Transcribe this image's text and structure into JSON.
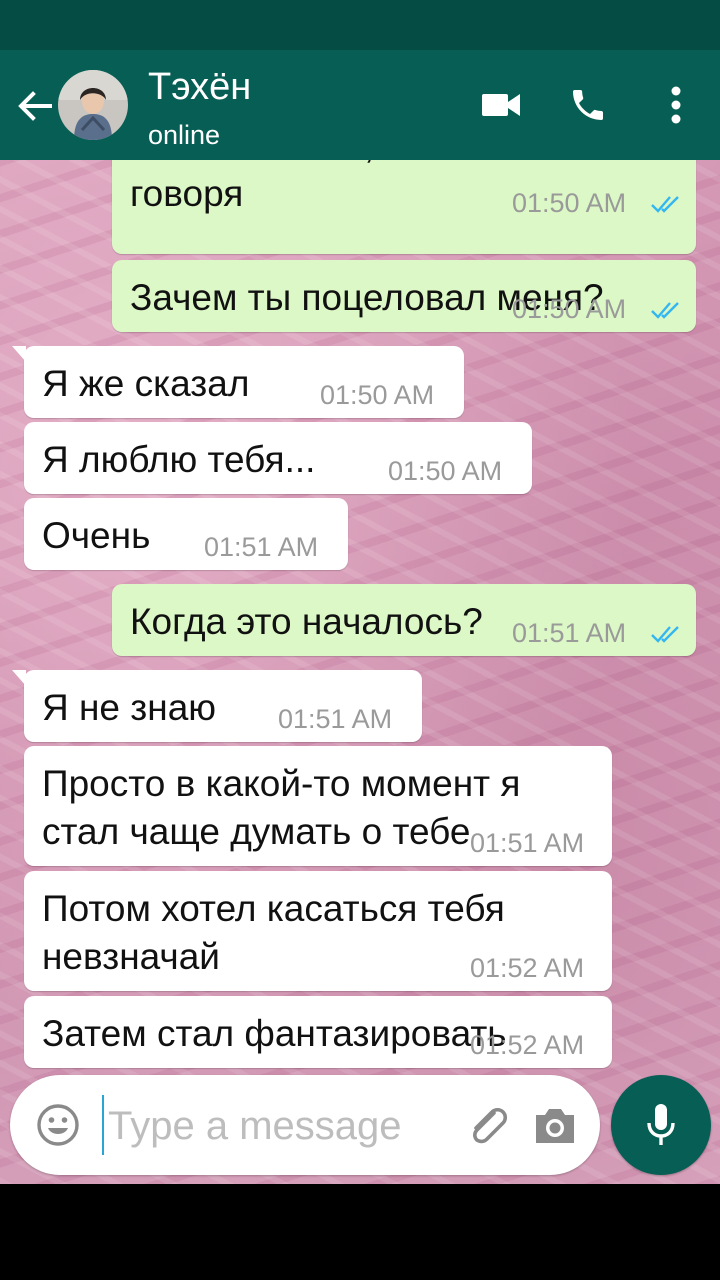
{
  "header": {
    "contact_name": "Тэхён",
    "status": "online",
    "icons": [
      "back-arrow-icon",
      "video-call-icon",
      "phone-icon",
      "more-vert-icon"
    ]
  },
  "messages": [
    {
      "direction": "out",
      "lines": [
        "Я был в шоке,честно",
        "говоря"
      ],
      "time": "01:50 AM",
      "read": true
    },
    {
      "direction": "out",
      "lines": [
        "Зачем ты поцеловал меня?"
      ],
      "time": "01:50 AM",
      "read": true
    },
    {
      "direction": "in",
      "lines": [
        "Я же сказал"
      ],
      "time": "01:50 AM"
    },
    {
      "direction": "in",
      "lines": [
        "Я люблю тебя..."
      ],
      "time": "01:50 AM"
    },
    {
      "direction": "in",
      "lines": [
        "Очень"
      ],
      "time": "01:51 AM"
    },
    {
      "direction": "out",
      "lines": [
        "Когда это началось?"
      ],
      "time": "01:51 AM",
      "read": true
    },
    {
      "direction": "in",
      "lines": [
        "Я не знаю"
      ],
      "time": "01:51 AM"
    },
    {
      "direction": "in",
      "lines": [
        "Просто в какой-то момент я",
        "стал чаще думать о тебе"
      ],
      "time": "01:51 AM"
    },
    {
      "direction": "in",
      "lines": [
        "Потом хотел касаться тебя",
        "невзначай"
      ],
      "time": "01:52 AM"
    },
    {
      "direction": "in",
      "lines": [
        "Затем стал фантазировать"
      ],
      "time": "01:52 AM"
    }
  ],
  "composer": {
    "placeholder": "Type a message",
    "icons": [
      "emoji-icon",
      "attach-icon",
      "camera-icon",
      "mic-icon"
    ]
  },
  "colors": {
    "header": "#075e54",
    "statusbar": "#054c44",
    "outgoing_bubble": "#dcf8c6",
    "incoming_bubble": "#ffffff",
    "read_tick": "#34b7f1"
  }
}
